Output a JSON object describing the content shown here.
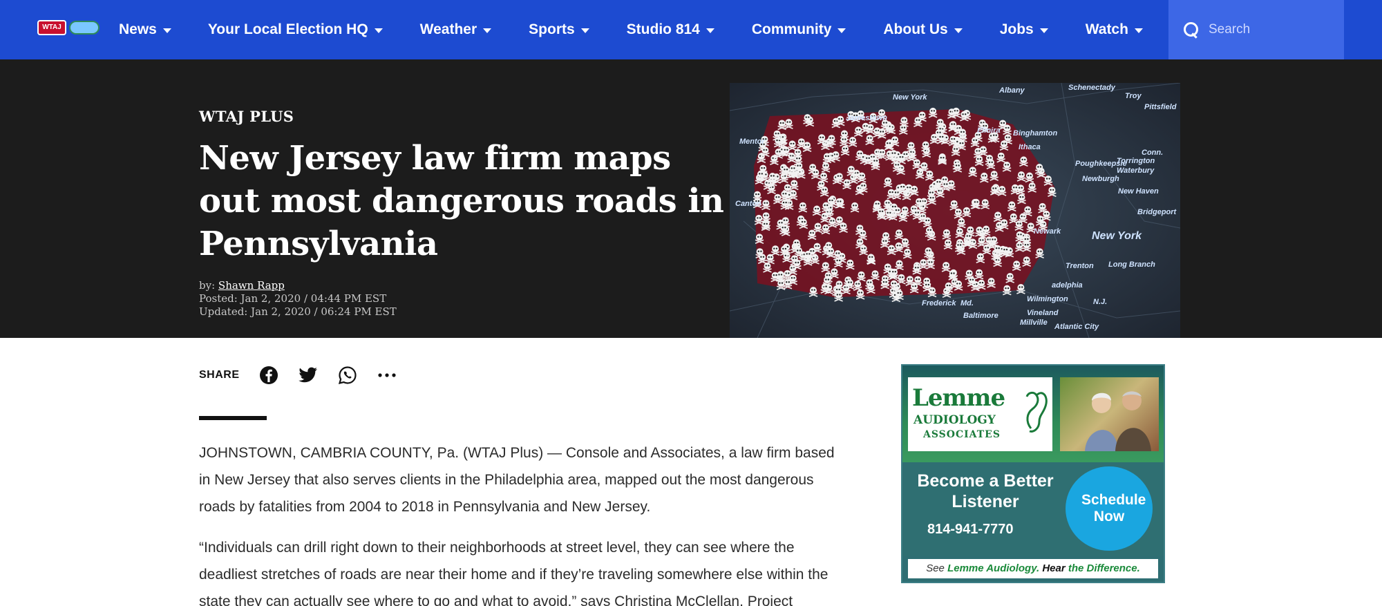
{
  "nav": {
    "items": [
      {
        "label": "News"
      },
      {
        "label": "Your Local Election HQ"
      },
      {
        "label": "Weather"
      },
      {
        "label": "Sports"
      },
      {
        "label": "Studio 814"
      },
      {
        "label": "Community"
      },
      {
        "label": "About Us"
      },
      {
        "label": "Jobs"
      },
      {
        "label": "Watch"
      }
    ],
    "search_placeholder": "Search",
    "color": "#1d4bd1"
  },
  "article": {
    "kicker": "WTAJ PLUS",
    "headline": "New Jersey law firm maps out most dangerous roads in Pennsylvania",
    "by_label": "by:",
    "author": "Shawn Rapp",
    "posted": "Posted: Jan 2, 2020 / 04:44 PM EST",
    "updated": "Updated: Jan 2, 2020 / 06:24 PM EST",
    "share_label": "SHARE",
    "paragraphs": [
      "JOHNSTOWN, CAMBRIA COUNTY, Pa. (WTAJ Plus) — Console and Associates, a law firm based in New Jersey that also serves clients in the Philadelphia area, mapped out the most dangerous roads by fatalities from 2004 to 2018 in Pennsylvania and New Jersey.",
      "“Individuals can drill right down to their neighborhoods at street level, they can see where the deadliest stretches of roads are near their home and if they’re traveling somewhere else within the state they can actually see where to go and what to avoid,” says Christina McClellan, Project"
    ]
  },
  "hero_map": {
    "labels": [
      "New York",
      "Albany",
      "Schenectady",
      "Troy",
      "Pittsfield",
      "Jamestown",
      "Elmira",
      "Binghamton",
      "Ithaca",
      "Conn.",
      "Torrington",
      "Poughkeepsie",
      "Waterbury",
      "Newburgh",
      "New Haven",
      "Bridgeport",
      "Newark",
      "New York",
      "Long Branch",
      "Trenton",
      "adelphia",
      "N.J.",
      "Md.",
      "Baltimore",
      "Frederick",
      "Vineland",
      "Atlantic City",
      "Millville",
      "Wilmington",
      "Mentor",
      "Canton"
    ]
  },
  "ad": {
    "brand": "Lemme",
    "brand_line2": "AUDIOLOGY",
    "brand_line3": "ASSOCIATES",
    "headline": "Become a Better Listener",
    "phone": "814-941-7770",
    "cta": "Schedule Now",
    "footer_see": "See",
    "footer_brand": "Lemme Audiology.",
    "footer_hear": "Hear",
    "footer_rest": "the Difference."
  }
}
